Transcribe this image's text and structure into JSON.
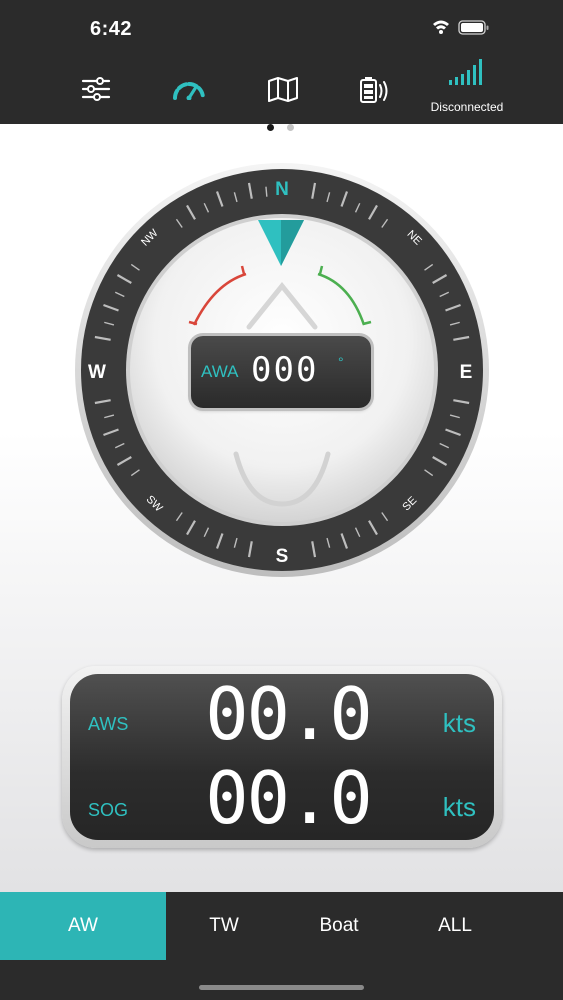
{
  "status_bar": {
    "time": "6:42",
    "icons": [
      "wifi-icon",
      "battery-icon"
    ]
  },
  "top_nav": {
    "items": [
      {
        "name": "settings",
        "icon": "sliders-icon",
        "active": false
      },
      {
        "name": "gauge",
        "icon": "gauge-icon",
        "active": true
      },
      {
        "name": "map",
        "icon": "map-icon",
        "active": false
      },
      {
        "name": "battery",
        "icon": "battery-signal-icon",
        "active": false
      },
      {
        "name": "connection",
        "icon": "signal-bars-icon",
        "active": false,
        "label": "Disconnected"
      }
    ]
  },
  "pager": {
    "count": 2,
    "current": 1
  },
  "compass": {
    "cardinals": {
      "n": "N",
      "e": "E",
      "s": "S",
      "w": "W"
    },
    "intercardinals": {
      "ne": "NE",
      "se": "SE",
      "sw": "SW",
      "nw": "NW"
    },
    "awa": {
      "label": "AWA",
      "value": "000",
      "unit": "°"
    }
  },
  "speeds": [
    {
      "label": "AWS",
      "value": "00.0",
      "unit": "kts"
    },
    {
      "label": "SOG",
      "value": "00.0",
      "unit": "kts"
    }
  ],
  "bottom_tabs": {
    "items": [
      {
        "label": "AW",
        "active": true
      },
      {
        "label": "TW",
        "active": false
      },
      {
        "label": "Boat",
        "active": false
      },
      {
        "label": "ALL",
        "active": false
      }
    ]
  },
  "colors": {
    "accent": "#2fc0c0",
    "active_tab": "#2db5b5",
    "bar_bg": "#2b2b2b",
    "port_red": "#d9463a",
    "starboard_green": "#4caf50"
  }
}
